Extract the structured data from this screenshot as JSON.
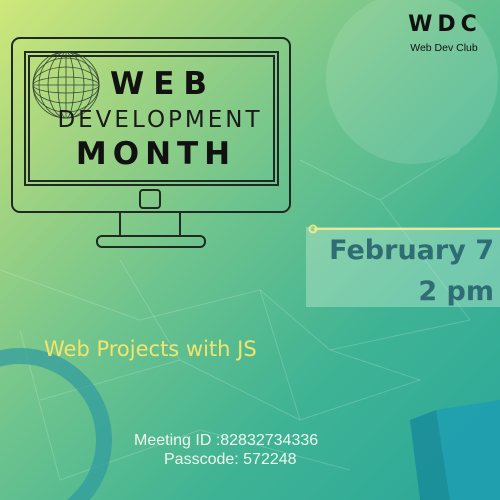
{
  "club": {
    "name": "WDC",
    "subtitle": "Web Dev Club"
  },
  "headline": {
    "line1": "WEB",
    "line2": "DEVELOPMENT",
    "line3": "MONTH"
  },
  "schedule": {
    "date": "February 7",
    "time": "2 pm"
  },
  "event_title": "Web Projects with JS",
  "meeting": {
    "id_text": "Meeting ID :82832734336",
    "passcode_text": "Passcode: 572248"
  },
  "colors": {
    "background_start": "#cfe87a",
    "background_end": "#2aa79a",
    "event_title": "#f4e46c",
    "schedule_text": "#2e6d73",
    "outline": "#1f2a22"
  },
  "icons": [
    "computer-monitor-icon",
    "globe-icon"
  ]
}
